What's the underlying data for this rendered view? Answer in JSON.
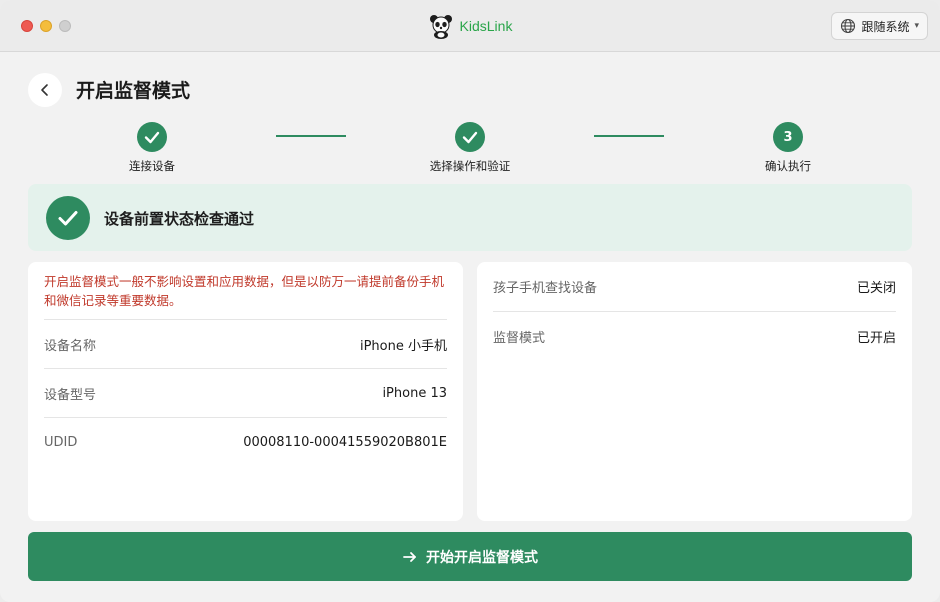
{
  "app": {
    "brand": "KidsLink",
    "language_label": "跟随系统",
    "icons": {
      "panda": "panda-logo",
      "globe": "globe-icon",
      "chevron": "chevron-down-icon"
    }
  },
  "header": {
    "title": "开启监督模式",
    "back_icon": "chevron-left-icon"
  },
  "steps": [
    {
      "label": "连接设备",
      "state": "done"
    },
    {
      "label": "选择操作和验证",
      "state": "done"
    },
    {
      "label": "确认执行",
      "number": "3",
      "state": "active"
    }
  ],
  "status": {
    "text": "设备前置状态检查通过",
    "color": "#2e8b60"
  },
  "left_panel": {
    "warning": "开启监督模式一般不影响设置和应用数据，但是以防万一请提前备份手机和微信记录等重要数据。",
    "rows": [
      {
        "key": "设备名称",
        "value": "iPhone 小手机"
      },
      {
        "key": "设备型号",
        "value": "iPhone 13"
      },
      {
        "key": "UDID",
        "value": "00008110-00041559020B801E"
      }
    ]
  },
  "right_panel": {
    "rows": [
      {
        "key": "孩子手机查找设备",
        "value": "已关闭"
      },
      {
        "key": "监督模式",
        "value": "已开启"
      }
    ]
  },
  "action": {
    "label": "开始开启监督模式",
    "icon": "arrow-right-icon"
  },
  "colors": {
    "accent": "#2e8b60",
    "warning": "#c0392b",
    "success_bg": "#e4f2ec"
  }
}
